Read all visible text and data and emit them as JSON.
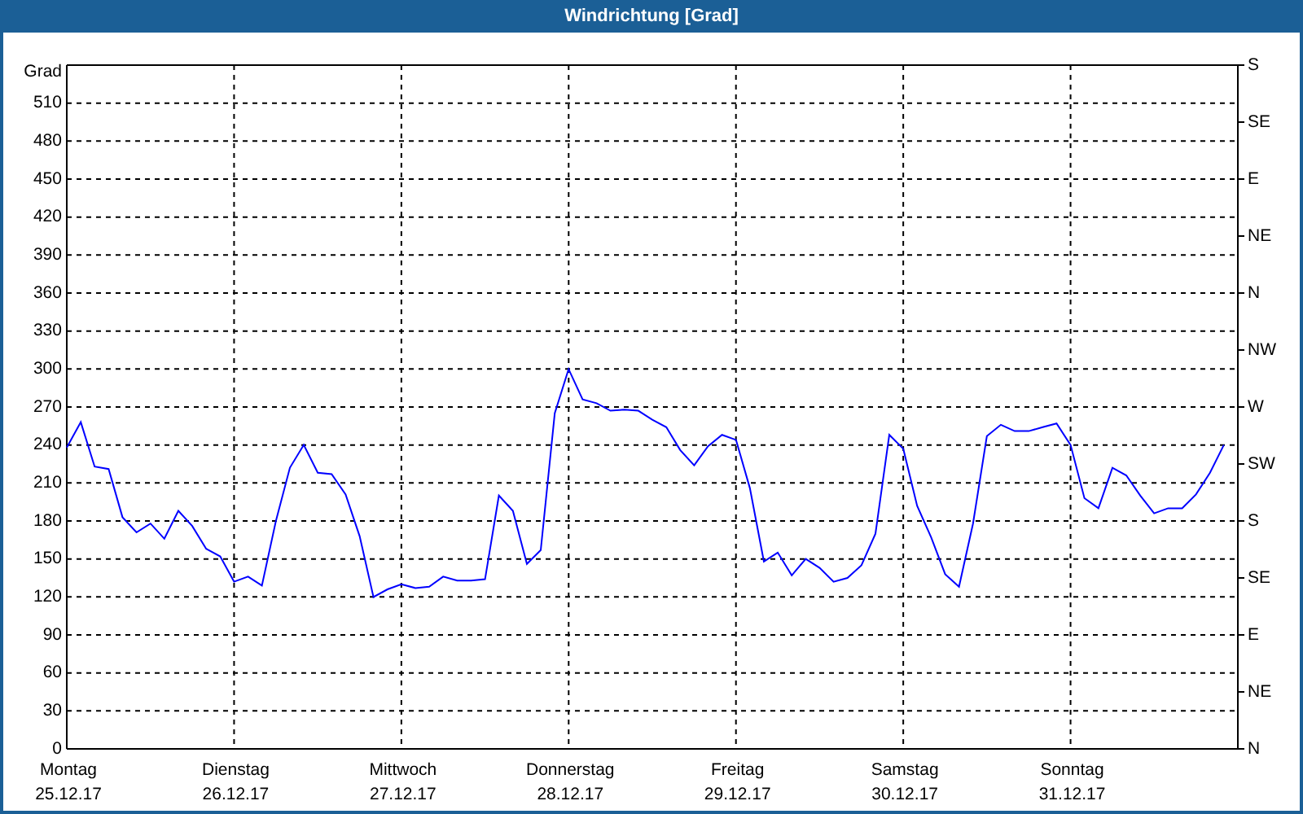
{
  "window": {
    "title": "Windrichtung [Grad]"
  },
  "compass_scale": [
    "S",
    "SE",
    "E",
    "NE",
    "N",
    "NW",
    "W",
    "SW",
    "S",
    "SE",
    "E",
    "NE",
    "N"
  ],
  "chart_data": {
    "type": "line",
    "ylabel": "Grad",
    "ylim": [
      0,
      540
    ],
    "grid": true,
    "yticks": [
      0,
      30,
      60,
      90,
      120,
      150,
      180,
      210,
      240,
      270,
      300,
      330,
      360,
      390,
      420,
      450,
      480,
      510
    ],
    "categories": [
      "Montag\n25.12.17",
      null,
      null,
      null,
      null,
      null,
      null,
      null,
      null,
      null,
      null,
      null,
      "Dienstag\n26.12.17",
      null,
      null,
      null,
      null,
      null,
      null,
      null,
      null,
      null,
      null,
      null,
      "Mittwoch\n27.12.17",
      null,
      null,
      null,
      null,
      null,
      null,
      null,
      null,
      null,
      null,
      null,
      "Donnerstag\n28.12.17",
      null,
      null,
      null,
      null,
      null,
      null,
      null,
      null,
      null,
      null,
      null,
      "Freitag\n29.12.17",
      null,
      null,
      null,
      null,
      null,
      null,
      null,
      null,
      null,
      null,
      null,
      "Samstag\n30.12.17",
      null,
      null,
      null,
      null,
      null,
      null,
      null,
      null,
      null,
      null,
      null,
      "Sonntag\n31.12.17",
      null,
      null,
      null,
      null,
      null,
      null,
      null,
      null,
      null,
      null,
      null
    ],
    "series": [
      {
        "color": "#0000ff",
        "values": [
          238,
          258,
          223,
          221,
          183,
          171,
          178,
          166,
          188,
          176,
          158,
          152,
          132,
          136,
          129,
          180,
          222,
          240,
          218,
          217,
          201,
          168,
          120,
          126,
          130,
          127,
          128,
          136,
          133,
          133,
          134,
          200,
          188,
          146,
          157,
          265,
          300,
          276,
          273,
          267,
          268,
          267,
          260,
          254,
          236,
          224,
          239,
          248,
          244,
          206,
          148,
          155,
          137,
          150,
          143,
          132,
          135,
          145,
          170,
          248,
          237,
          192,
          167,
          138,
          128,
          178,
          247,
          256,
          251,
          251,
          254,
          257,
          240,
          198,
          190,
          222,
          216,
          200,
          186,
          190,
          190,
          201,
          218,
          240
        ]
      }
    ]
  }
}
